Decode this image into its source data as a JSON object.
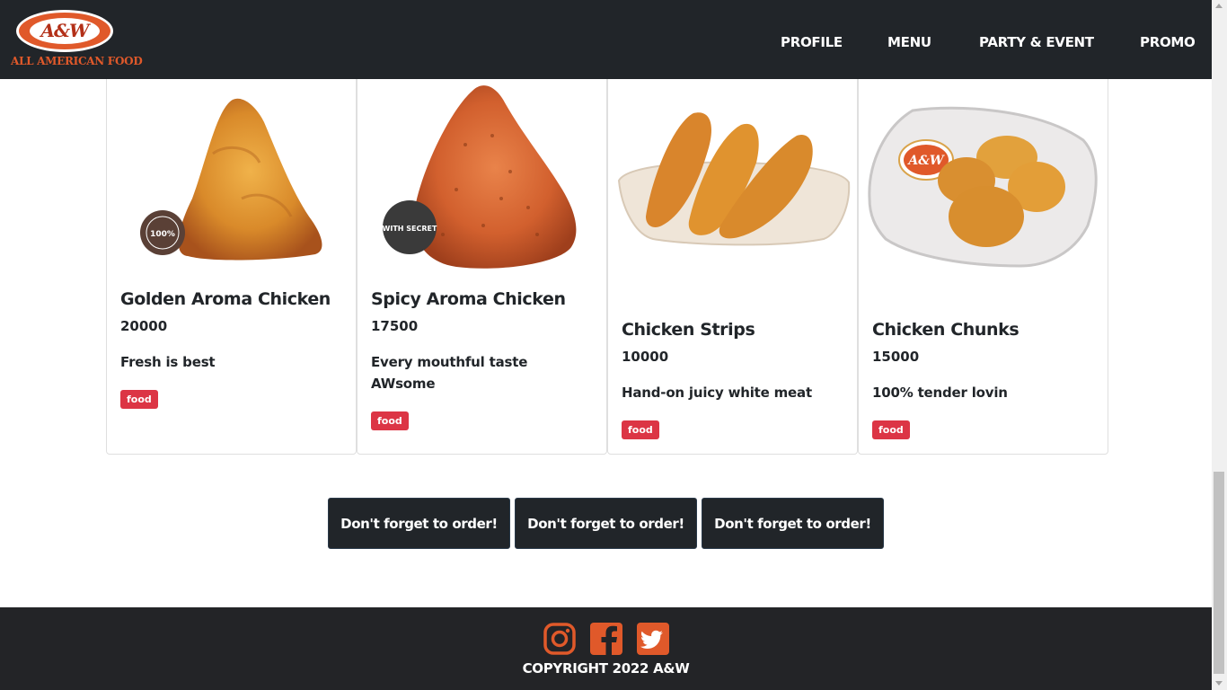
{
  "brand": {
    "logo_text": "A&W",
    "logo_tagline": "ALL AMERICAN FOOD",
    "colors": {
      "orange": "#e0592a",
      "dark": "#212529",
      "badge": "#dc3545"
    }
  },
  "nav": {
    "items": [
      {
        "label": "PROFILE"
      },
      {
        "label": "MENU"
      },
      {
        "label": "PARTY & EVENT"
      },
      {
        "label": "PROMO"
      }
    ]
  },
  "products": [
    {
      "name": "Golden Aroma Chicken",
      "price": "20000",
      "description": "Fresh is best",
      "category": "food",
      "image": "golden-chicken-image",
      "stamp": "FRESH NOT FROZEN 100%"
    },
    {
      "name": "Spicy Aroma Chicken",
      "price": "17500",
      "description": "Every mouthful taste AWsome",
      "category": "food",
      "image": "spicy-chicken-image",
      "stamp": "WITH SECRET"
    },
    {
      "name": "Chicken Strips",
      "price": "10000",
      "description": "Hand-on juicy white meat",
      "category": "food",
      "image": "chicken-strips-image"
    },
    {
      "name": "Chicken Chunks",
      "price": "15000",
      "description": "100% tender lovin",
      "category": "food",
      "image": "chicken-chunks-image",
      "plate_logo": "A&W"
    }
  ],
  "cta": {
    "buttons": [
      {
        "label": "Don't forget to order!"
      },
      {
        "label": "Don't forget to order!"
      },
      {
        "label": "Don't forget to order!"
      }
    ]
  },
  "footer": {
    "social": [
      {
        "icon": "instagram-icon",
        "color": "#e0592a"
      },
      {
        "icon": "facebook-icon",
        "color": "#e0592a"
      },
      {
        "icon": "twitter-icon",
        "color": "#e0592a"
      }
    ],
    "copyright": "COPYRIGHT 2022 A&W"
  }
}
